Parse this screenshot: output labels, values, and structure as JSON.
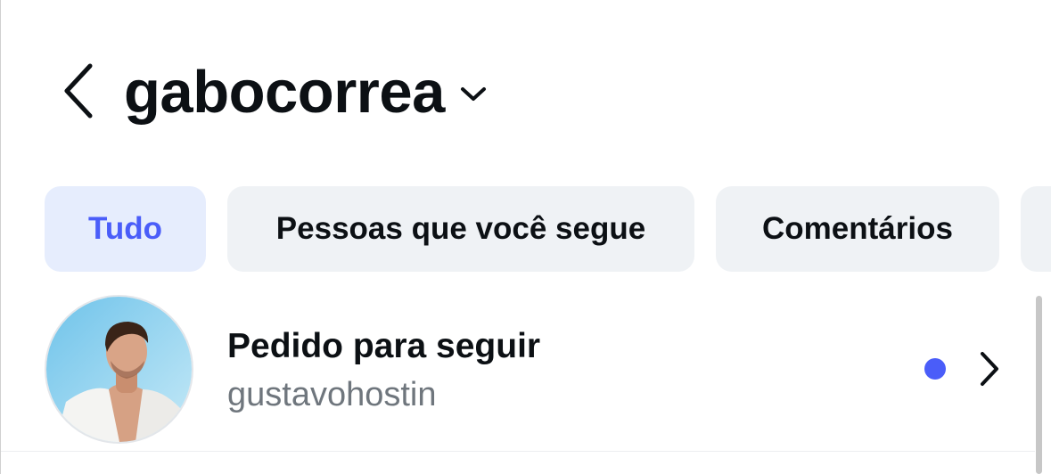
{
  "header": {
    "back_icon": "chevron-left-icon",
    "title": "gabocorrea",
    "title_dropdown_icon": "chevron-down-icon"
  },
  "filters": [
    {
      "label": "Tudo",
      "active": true
    },
    {
      "label": "Pessoas que você segue",
      "active": false
    },
    {
      "label": "Comentários",
      "active": false
    },
    {
      "label": "",
      "active": false
    }
  ],
  "colors": {
    "accent": "#4a5df9",
    "active_chip_bg": "#e6edfd",
    "chip_bg": "#eff2f5",
    "text_primary": "#0c1014",
    "text_secondary": "#6f767d"
  },
  "notifications": [
    {
      "title": "Pedido para seguir",
      "subtitle": "gustavohostin",
      "unread": true,
      "chevron_icon": "chevron-right-icon"
    }
  ]
}
